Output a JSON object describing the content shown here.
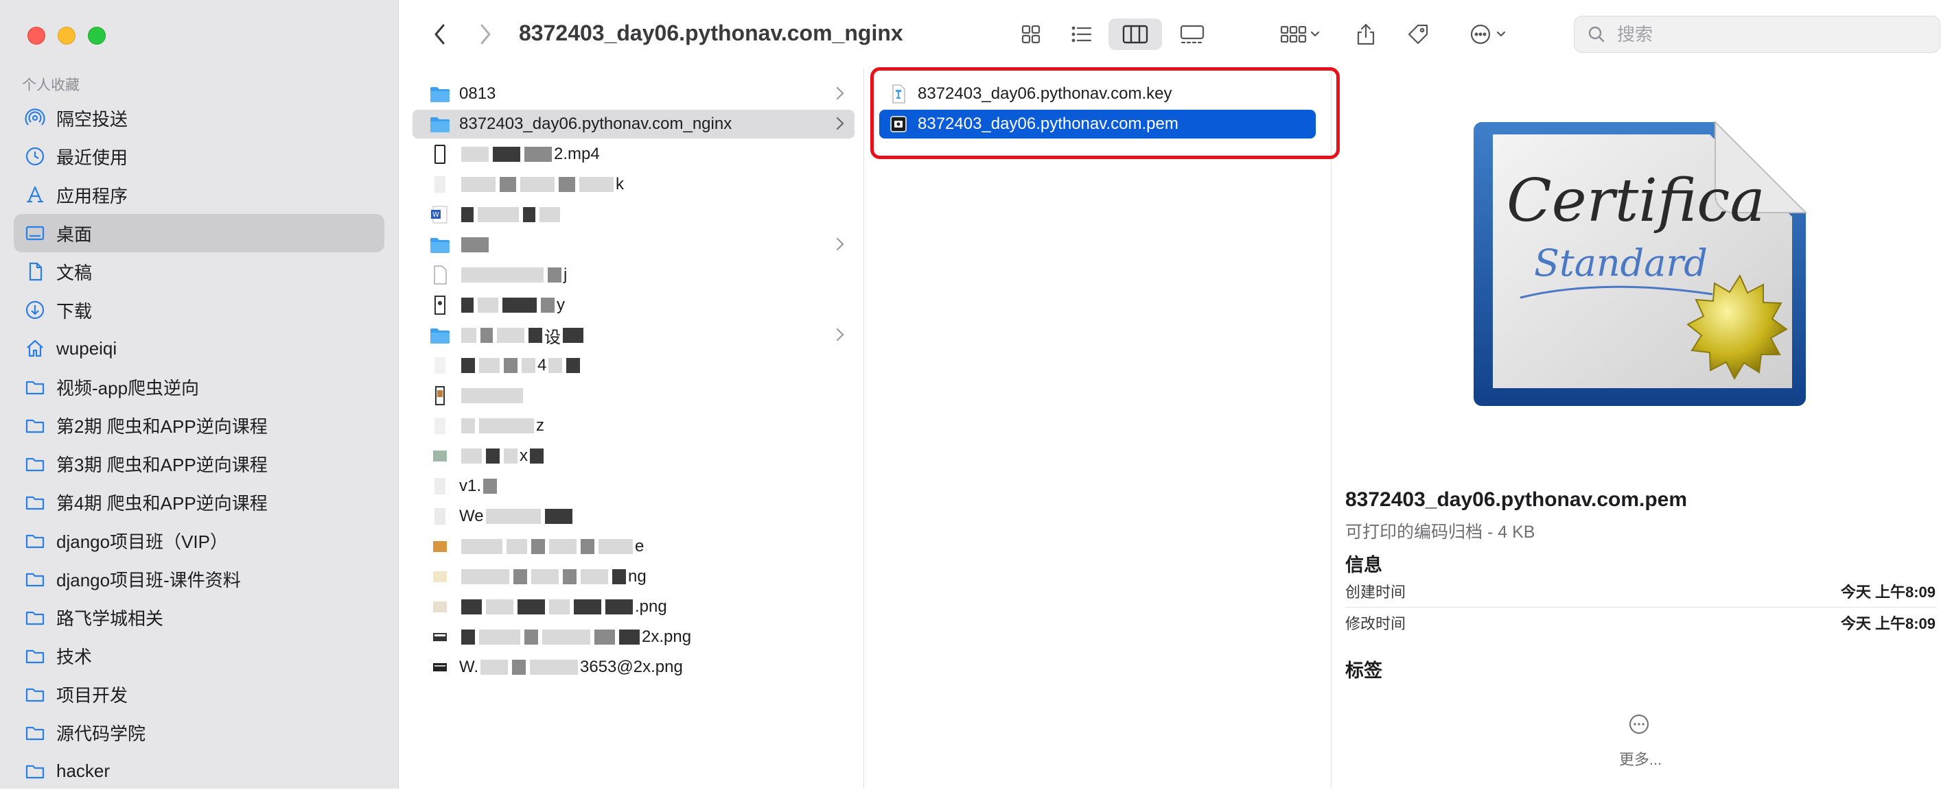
{
  "sidebar": {
    "section_title": "个人收藏",
    "items": [
      {
        "label": "隔空投送",
        "icon": "airdrop-icon"
      },
      {
        "label": "最近使用",
        "icon": "clock-icon"
      },
      {
        "label": "应用程序",
        "icon": "applications-icon"
      },
      {
        "label": "桌面",
        "icon": "desktop-icon",
        "selected": true
      },
      {
        "label": "文稿",
        "icon": "document-icon"
      },
      {
        "label": "下载",
        "icon": "download-icon"
      },
      {
        "label": "wupeiqi",
        "icon": "home-icon"
      },
      {
        "label": "视频-app爬虫逆向",
        "icon": "folder-icon"
      },
      {
        "label": "第2期 爬虫和APP逆向课程",
        "icon": "folder-icon"
      },
      {
        "label": "第3期 爬虫和APP逆向课程",
        "icon": "folder-icon"
      },
      {
        "label": "第4期 爬虫和APP逆向课程",
        "icon": "folder-icon"
      },
      {
        "label": "django项目班（VIP）",
        "icon": "folder-icon"
      },
      {
        "label": "django项目班-课件资料",
        "icon": "folder-icon"
      },
      {
        "label": "路飞学城相关",
        "icon": "folder-icon"
      },
      {
        "label": "技术",
        "icon": "folder-icon"
      },
      {
        "label": "项目开发",
        "icon": "folder-icon"
      },
      {
        "label": "源代码学院",
        "icon": "folder-icon"
      },
      {
        "label": "hacker",
        "icon": "folder-icon"
      }
    ]
  },
  "toolbar": {
    "title": "8372403_day06.pythonav.com_nginx",
    "search_placeholder": "搜索"
  },
  "column1": {
    "visible_items": [
      {
        "label": "0813",
        "icon": "folder-icon",
        "has_children": true
      },
      {
        "label": "8372403_day06.pythonav.com_nginx",
        "icon": "folder-icon",
        "has_children": true,
        "selected": true
      },
      {
        "label": "2.mp4"
      },
      {
        "label": "k"
      },
      {
        "label": "j"
      },
      {
        "label": "y"
      },
      {
        "label": "设"
      },
      {
        "label": "4"
      },
      {
        "label": "z"
      },
      {
        "label": "x"
      },
      {
        "label": "v1."
      },
      {
        "label": "We"
      },
      {
        "label": "e"
      },
      {
        "label": "ng"
      },
      {
        "label": ".png"
      },
      {
        "label": "2x.png"
      },
      {
        "label": "W."
      },
      {
        "label": "3653@2x.png"
      }
    ]
  },
  "column2": {
    "items": [
      {
        "label": "8372403_day06.pythonav.com.key",
        "icon": "key-file-icon"
      },
      {
        "label": "8372403_day06.pythonav.com.pem",
        "icon": "certificate-file-icon",
        "selected": true
      }
    ]
  },
  "preview": {
    "file_name": "8372403_day06.pythonav.com.pem",
    "kind_size": "可打印的编码归档 - 4 KB",
    "info_heading": "信息",
    "created_label": "创建时间",
    "created_value": "今天 上午8:09",
    "modified_label": "修改时间",
    "modified_value": "今天 上午8:09",
    "tags_heading": "标签",
    "more_label": "更多..."
  },
  "colors": {
    "selection_blue": "#0a5bd8",
    "annotation_red": "#e8111b",
    "sidebar_bg": "#e6e6e8",
    "folder_blue": "#3aa0ef"
  }
}
